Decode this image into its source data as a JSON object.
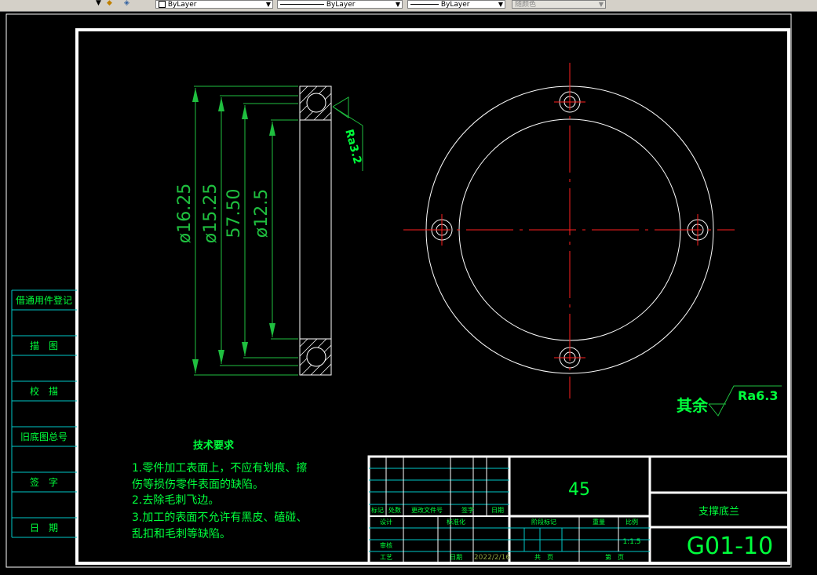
{
  "toolbar": {
    "layer_control": "ByLayer",
    "linetype_control": "ByLayer",
    "lineweight_control": "ByLayer",
    "color_control": "随颜色"
  },
  "colors": {
    "background": "#000000",
    "frame": "#ffffff",
    "dimension": "#1fbf3f",
    "text_green": "#00ff3c",
    "title_text": "#00ff3c",
    "cyan_lines": "#00c8c8",
    "centerline": "#ff2020"
  },
  "dimensions": {
    "d1": "ø16.25",
    "d2": "ø15.25",
    "d3": "57.50",
    "d4": "ø12.5",
    "roughness": "Ra3.2"
  },
  "surface_note": {
    "prefix": "其余",
    "value": "Ra6.3"
  },
  "side_column": [
    "借通用件登记",
    "描　图",
    "校　描",
    "旧底图总号",
    "签　字",
    "日　期"
  ],
  "tech_requirements": {
    "title": "技术要求",
    "lines": [
      "1.零件加工表面上，不应有划痕、擦",
      "伤等损伤零件表面的缺陷。",
      "2.去除毛刺飞边。",
      "3.加工的表面不允许有黑皮、磕碰、",
      "乱扣和毛刺等缺陷。"
    ]
  },
  "title_block": {
    "material": "45",
    "part_name": "支撑底兰",
    "drawing_number": "G01-10",
    "scale": "1:1.5",
    "date": "2022/2/16",
    "labels": {
      "mark": "标记",
      "count": "处数",
      "zone": "更改文件号",
      "sign": "签字",
      "date_h": "日期",
      "design": "设计",
      "standard": "标准化",
      "review": "审核",
      "process": "工艺",
      "approve": "日期",
      "stage": "阶段标记",
      "weight": "重量",
      "ratio": "比例",
      "total": "共　页",
      "sheet": "第　页"
    }
  }
}
